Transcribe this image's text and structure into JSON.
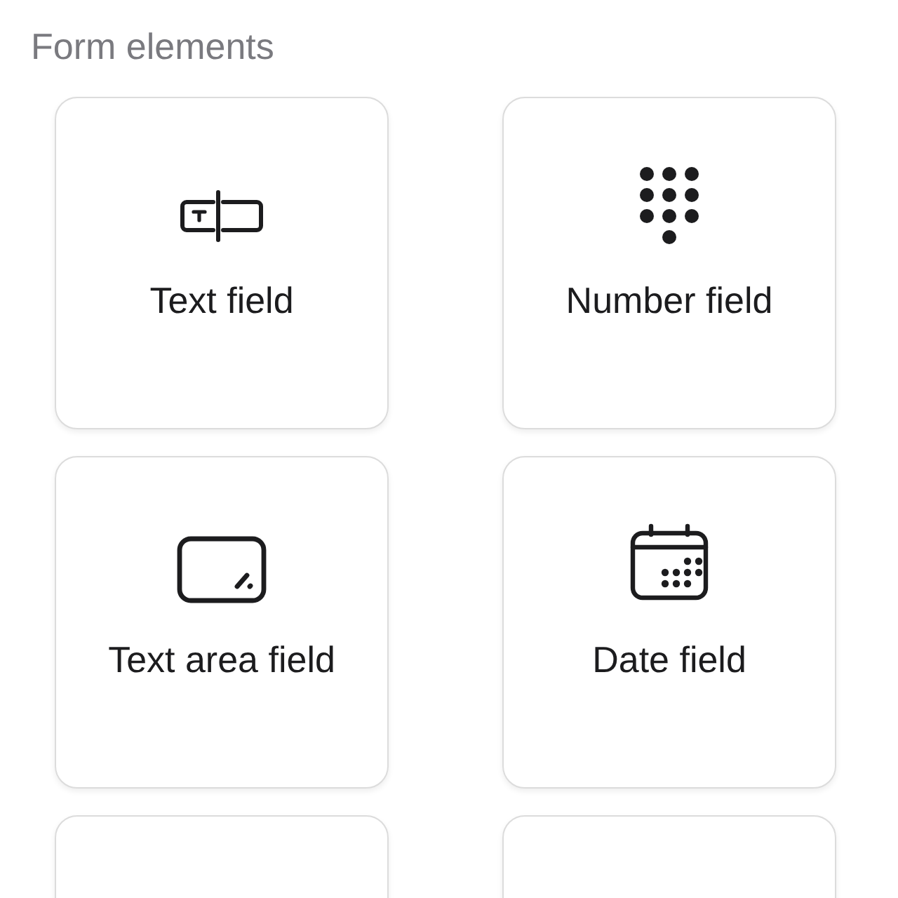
{
  "section_title": "Form elements",
  "cards": [
    {
      "kind": "text",
      "label": "Text field"
    },
    {
      "kind": "number",
      "label": "Number field"
    },
    {
      "kind": "textarea",
      "label": "Text area field"
    },
    {
      "kind": "date",
      "label": "Date field"
    },
    {
      "kind": "blank"
    },
    {
      "kind": "blank"
    }
  ]
}
